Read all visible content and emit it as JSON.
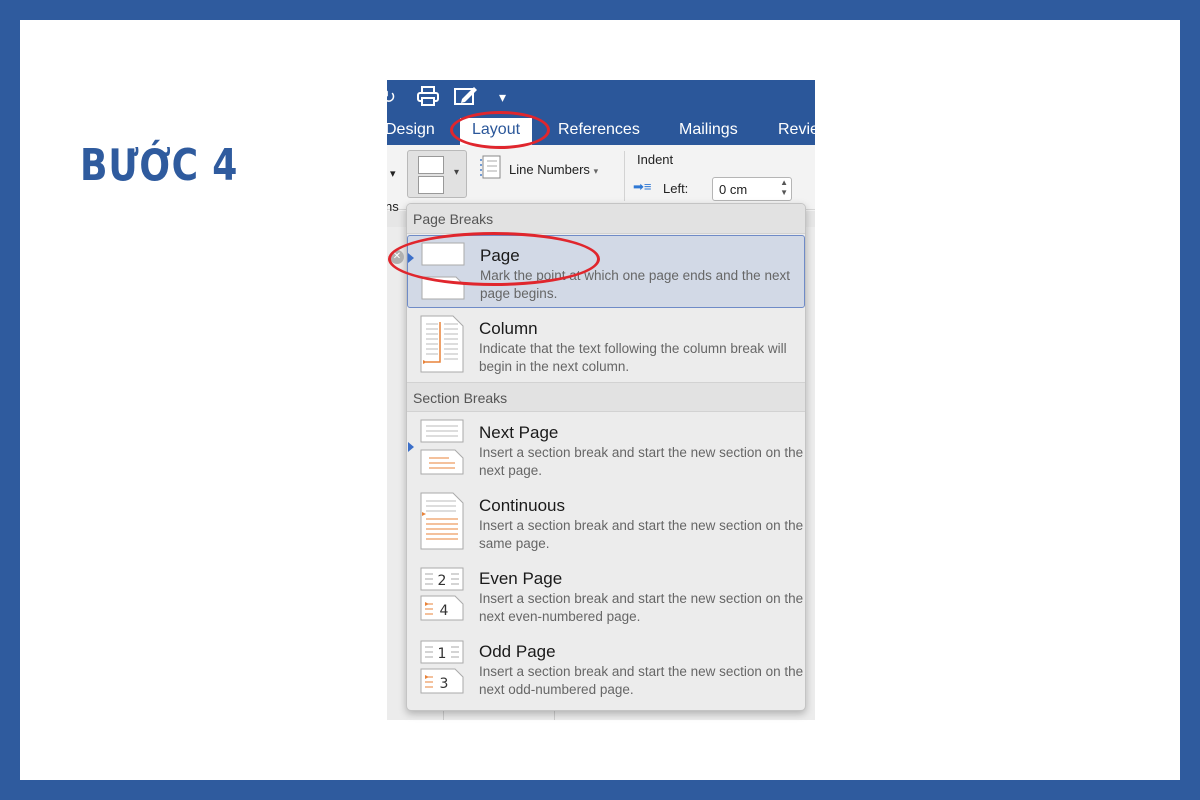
{
  "step_title": "BƯỚC 4",
  "tabs": {
    "design": "Design",
    "layout": "Layout",
    "references": "References",
    "mailings": "Mailings",
    "review": "Revie"
  },
  "ribbon": {
    "line_numbers": "Line Numbers",
    "indent": "Indent",
    "left_label": "Left:",
    "left_value": "0 cm",
    "cut_label": "ns"
  },
  "menu": {
    "page_breaks_header": "Page Breaks",
    "section_breaks_header": "Section Breaks",
    "items": [
      {
        "title": "Page",
        "desc": "Mark the point at which one page ends and the next page begins."
      },
      {
        "title": "Column",
        "desc": "Indicate that the text following the column break will begin in the next column."
      },
      {
        "title": "Next Page",
        "desc": "Insert a section break and start the new section on the next page."
      },
      {
        "title": "Continuous",
        "desc": "Insert a section break and start the new section on the same page."
      },
      {
        "title": "Even Page",
        "desc": "Insert a section break and start the new section on the next even-numbered page."
      },
      {
        "title": "Odd Page",
        "desc": "Insert a section break and start the new section on the next odd-numbered page."
      }
    ],
    "icon_numbers": {
      "even_top": "2",
      "even_bottom": "4",
      "odd_top": "1",
      "odd_bottom": "3"
    }
  },
  "colors": {
    "frame": "#2f5b9e",
    "word_blue": "#2b579a",
    "highlight_ring": "#e0262d",
    "accent_orange": "#e8833a"
  }
}
